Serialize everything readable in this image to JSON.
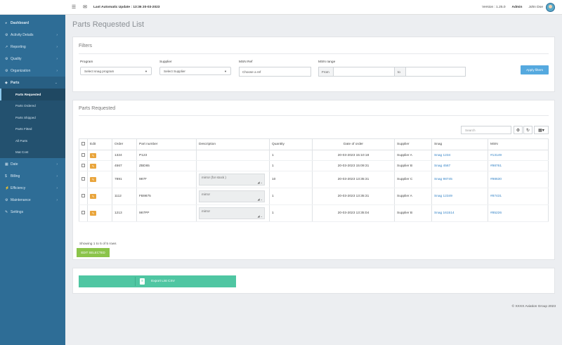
{
  "sidebar": {
    "items": [
      {
        "icon": "dashboard-icon",
        "glyph": "◕",
        "label": "Dashboard",
        "chevron": false
      },
      {
        "icon": "activity-icon",
        "glyph": "⚙",
        "label": "Activity Details",
        "chevron": true
      },
      {
        "icon": "reporting-icon",
        "glyph": "↗",
        "label": "Reporting",
        "chevron": true
      },
      {
        "icon": "quality-icon",
        "glyph": "⚙",
        "label": "Quality",
        "chevron": true
      },
      {
        "icon": "organization-icon",
        "glyph": "⚙",
        "label": "Organization",
        "chevron": true
      },
      {
        "icon": "parts-icon",
        "glyph": "◆",
        "label": "Parts",
        "chevron": true
      }
    ],
    "sub_items": [
      "Parts Requested",
      "Parts Ordered",
      "Parts Shipped",
      "Parts Fitted",
      "All Parts",
      "Mat Cost"
    ],
    "bottom_items": [
      {
        "icon": "date-icon",
        "glyph": "▦",
        "label": "Date",
        "chevron": true
      },
      {
        "icon": "billing-icon",
        "glyph": "$",
        "label": "Billing",
        "chevron": true
      },
      {
        "icon": "efficiency-icon",
        "glyph": "⚡",
        "label": "Efficiency",
        "chevron": true
      },
      {
        "icon": "maintenance-icon",
        "glyph": "⚙",
        "label": "Maintenance",
        "chevron": true
      },
      {
        "icon": "settings-icon",
        "glyph": "✎",
        "label": "Settings",
        "chevron": false
      }
    ]
  },
  "topbar": {
    "update": "Last Automatic Update : 13:36 20-03-2023",
    "version": "Version : 1.25.0",
    "role": "Admin",
    "user": "John Doe"
  },
  "page": {
    "title": "Parts Requested List"
  },
  "filters": {
    "title": "Filters",
    "program_label": "Program",
    "program_value": "Select snag program",
    "supplier_label": "Supplier",
    "supplier_value": "Select Supplier",
    "msn_ref_label": "MSN Ref",
    "msn_ref_placeholder": "Choose a ref",
    "msn_range_label": "MSN range",
    "from_label": "From",
    "to_label": "to",
    "apply_label": "Apply filters"
  },
  "list": {
    "title": "Parts Requested",
    "search_placeholder": "Search",
    "columns": [
      "",
      "Edit",
      "Order",
      "Part number",
      "Description",
      "Quantity",
      "Date of order",
      "Supplier",
      "Snag",
      "MSN"
    ],
    "rows": [
      {
        "order": "1324",
        "part": "P123",
        "desc": "",
        "qty": "1",
        "date": "20-03-2023 15:10:18",
        "supplier": "Supplier A",
        "snag": "Snag 1234",
        "msn": "#13149"
      },
      {
        "order": "4567",
        "part": "ZBD65",
        "desc": "",
        "qty": "1",
        "date": "20-03-2023 15:09:31",
        "supplier": "Supplier B",
        "snag": "Snag 4567",
        "msn": "#98761"
      },
      {
        "order": "7891",
        "part": "987F",
        "desc": "mirror (for stock )",
        "qty": "10",
        "date": "20-03-2023 13:35:31",
        "supplier": "Supplier C",
        "snag": "Snag 98745",
        "msn": "#98630"
      },
      {
        "order": "1112",
        "part": "FB9875",
        "desc": "mirror",
        "qty": "1",
        "date": "20-03-2023 13:35:31",
        "supplier": "Supplier A",
        "snag": "Snag 12349",
        "msn": "#87431"
      },
      {
        "order": "1213",
        "part": "987PP",
        "desc": "mirror",
        "qty": "1",
        "date": "20-03-2023 13:35:04",
        "supplier": "Supplier B",
        "snag": "Snag 161514",
        "msn": "#85226"
      }
    ],
    "showing": "Showing 1 to 5 of 5 rows",
    "edit_selected": "EDIT SELECTED"
  },
  "export": {
    "label": "Export List CSV"
  },
  "footer": {
    "text": "© XXXX Aviation Group 2023"
  },
  "colors": {
    "sidebar": "#2e6d96",
    "apply": "#55a9df",
    "edit_selected": "#8bc44a",
    "export": "#4fc6a2",
    "edit_icon": "#e9a53c"
  }
}
